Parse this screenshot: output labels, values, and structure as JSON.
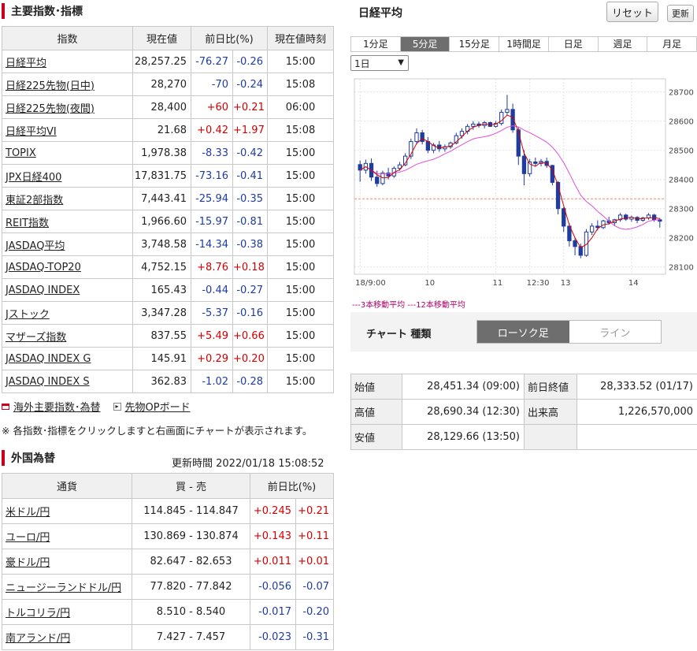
{
  "indices": {
    "title": "主要指数･指標",
    "headers": [
      "指数",
      "現在値",
      "前日比(%)",
      "現在値時刻"
    ],
    "rows": [
      {
        "name": "日経平均",
        "value": "28,257.25",
        "change": "-76.27",
        "pct": "-0.26",
        "time": "15:00"
      },
      {
        "name": "日経225先物(日中)",
        "value": "28,270",
        "change": "-70",
        "pct": "-0.24",
        "time": "15:08"
      },
      {
        "name": "日経225先物(夜間)",
        "value": "28,400",
        "change": "+60",
        "pct": "+0.21",
        "time": "06:00"
      },
      {
        "name": "日経平均VI",
        "value": "21.68",
        "change": "+0.42",
        "pct": "+1.97",
        "time": "15:08"
      },
      {
        "name": "TOPIX",
        "value": "1,978.38",
        "change": "-8.33",
        "pct": "-0.42",
        "time": "15:00"
      },
      {
        "name": "JPX日経400",
        "value": "17,831.75",
        "change": "-73.16",
        "pct": "-0.41",
        "time": "15:00"
      },
      {
        "name": "東証2部指数",
        "value": "7,443.41",
        "change": "-25.94",
        "pct": "-0.35",
        "time": "15:00"
      },
      {
        "name": "REIT指数",
        "value": "1,966.60",
        "change": "-15.97",
        "pct": "-0.81",
        "time": "15:00"
      },
      {
        "name": "JASDAQ平均",
        "value": "3,748.58",
        "change": "-14.34",
        "pct": "-0.38",
        "time": "15:00"
      },
      {
        "name": "JASDAQ-TOP20",
        "value": "4,752.15",
        "change": "+8.76",
        "pct": "+0.18",
        "time": "15:00"
      },
      {
        "name": "JASDAQ INDEX",
        "value": "165.43",
        "change": "-0.44",
        "pct": "-0.27",
        "time": "15:00"
      },
      {
        "name": "Jストック",
        "value": "3,347.28",
        "change": "-5.37",
        "pct": "-0.16",
        "time": "15:00"
      },
      {
        "name": "マザーズ指数",
        "value": "837.55",
        "change": "+5.49",
        "pct": "+0.66",
        "time": "15:00"
      },
      {
        "name": "JASDAQ INDEX G",
        "value": "145.91",
        "change": "+0.29",
        "pct": "+0.20",
        "time": "15:00"
      },
      {
        "name": "JASDAQ INDEX S",
        "value": "362.83",
        "change": "-1.02",
        "pct": "-0.28",
        "time": "15:00"
      }
    ],
    "link_overseas": "海外主要指数･為替",
    "link_options": "先物OPボード",
    "note": "※ 各指数･指標をクリックしますと右画面にチャートが表示されます。"
  },
  "fx": {
    "title": "外国為替",
    "updated": "更新時間 2022/01/18 15:08:52",
    "headers": [
      "通貨",
      "買 - 売",
      "前日比(%)"
    ],
    "rows": [
      {
        "name": "米ドル/円",
        "bidask": "114.845 - 114.847",
        "change": "+0.245",
        "pct": "+0.21"
      },
      {
        "name": "ユーロ/円",
        "bidask": "130.869 - 130.874",
        "change": "+0.143",
        "pct": "+0.11"
      },
      {
        "name": "豪ドル/円",
        "bidask": "82.647 - 82.653",
        "change": "+0.011",
        "pct": "+0.01"
      },
      {
        "name": "ニュージーランドドル/円",
        "bidask": "77.820 - 77.842",
        "change": "-0.056",
        "pct": "-0.07"
      },
      {
        "name": "トルコリラ/円",
        "bidask": "8.510 - 8.540",
        "change": "-0.017",
        "pct": "-0.20"
      },
      {
        "name": "南アランド/円",
        "bidask": "7.427 - 7.457",
        "change": "-0.023",
        "pct": "-0.31"
      }
    ]
  },
  "chart_panel": {
    "title": "日経平均",
    "reset_label": "リセット",
    "refresh_label": "更新",
    "tabs": [
      "1分足",
      "5分足",
      "15分足",
      "1時間足",
      "日足",
      "週足",
      "月足"
    ],
    "active_tab": "5分足",
    "period_selected": "1日",
    "legend": "---3本移動平均 ---12本移動平均",
    "type_label": "チャート 種類",
    "type_candle": "ローソク足",
    "type_line": "ライン",
    "colors": {
      "up": "#1f3c9e",
      "down": "#1f3c9e",
      "ma3": "#d40000",
      "ma12": "#e24fd6",
      "prev_close": "#e8905a"
    }
  },
  "summary": {
    "open_label": "始値",
    "open_value": "28,451.34 (09:00)",
    "high_label": "高値",
    "high_value": "28,690.34 (12:30)",
    "low_label": "安値",
    "low_value": "28,129.66 (13:50)",
    "prevclose_label": "前日終値",
    "prevclose_value": "28,333.52 (01/17)",
    "volume_label": "出来高",
    "volume_value": "1,226,570,000"
  },
  "chart_data": {
    "type": "candlestick",
    "y_ticks": [
      28100,
      28200,
      28300,
      28400,
      28500,
      28600,
      28700
    ],
    "ylim": [
      28075,
      28745
    ],
    "x_tick_labels": [
      "18/9:00",
      "10",
      "11",
      "12:30",
      "13",
      "14"
    ],
    "prev_close": 28333.52,
    "candles": [
      [
        28451,
        28465,
        28392,
        28432
      ],
      [
        28432,
        28468,
        28420,
        28455
      ],
      [
        28455,
        28472,
        28395,
        28408
      ],
      [
        28408,
        28430,
        28375,
        28386
      ],
      [
        28386,
        28430,
        28380,
        28422
      ],
      [
        28422,
        28440,
        28400,
        28412
      ],
      [
        28412,
        28445,
        28405,
        28438
      ],
      [
        28438,
        28460,
        28430,
        28450
      ],
      [
        28450,
        28490,
        28445,
        28480
      ],
      [
        28480,
        28540,
        28470,
        28530
      ],
      [
        28530,
        28575,
        28520,
        28560
      ],
      [
        28560,
        28570,
        28520,
        28530
      ],
      [
        28530,
        28545,
        28490,
        28500
      ],
      [
        28500,
        28525,
        28490,
        28518
      ],
      [
        28518,
        28532,
        28495,
        28505
      ],
      [
        28505,
        28520,
        28495,
        28512
      ],
      [
        28512,
        28530,
        28505,
        28525
      ],
      [
        28525,
        28560,
        28520,
        28550
      ],
      [
        28550,
        28575,
        28540,
        28565
      ],
      [
        28565,
        28590,
        28555,
        28582
      ],
      [
        28582,
        28600,
        28570,
        28590
      ],
      [
        28590,
        28598,
        28578,
        28585
      ],
      [
        28585,
        28600,
        28575,
        28595
      ],
      [
        28595,
        28598,
        28580,
        28582
      ],
      [
        28582,
        28600,
        28578,
        28592
      ],
      [
        28592,
        28640,
        28585,
        28630
      ],
      [
        28630,
        28690,
        28620,
        28640
      ],
      [
        28640,
        28660,
        28560,
        28570
      ],
      [
        28570,
        28580,
        28450,
        28480
      ],
      [
        28480,
        28500,
        28380,
        28420
      ],
      [
        28420,
        28470,
        28410,
        28460
      ],
      [
        28460,
        28475,
        28445,
        28455
      ],
      [
        28455,
        28470,
        28445,
        28462
      ],
      [
        28462,
        28475,
        28440,
        28448
      ],
      [
        28448,
        28450,
        28380,
        28390
      ],
      [
        28390,
        28395,
        28280,
        28300
      ],
      [
        28300,
        28305,
        28220,
        28240
      ],
      [
        28240,
        28250,
        28170,
        28190
      ],
      [
        28190,
        28200,
        28140,
        28170
      ],
      [
        28170,
        28180,
        28130,
        28140
      ],
      [
        28140,
        28230,
        28135,
        28220
      ],
      [
        28220,
        28250,
        28210,
        28240
      ],
      [
        28240,
        28260,
        28225,
        28235
      ],
      [
        28235,
        28262,
        28230,
        28258
      ],
      [
        28258,
        28272,
        28245,
        28252
      ],
      [
        28252,
        28265,
        28240,
        28262
      ],
      [
        28262,
        28285,
        28255,
        28278
      ],
      [
        28278,
        28282,
        28258,
        28264
      ],
      [
        28264,
        28276,
        28255,
        28270
      ],
      [
        28270,
        28274,
        28250,
        28260
      ],
      [
        28260,
        28272,
        28255,
        28268
      ],
      [
        28268,
        28285,
        28262,
        28278
      ],
      [
        28278,
        28282,
        28255,
        28262
      ],
      [
        28262,
        28268,
        28235,
        28257
      ]
    ]
  }
}
